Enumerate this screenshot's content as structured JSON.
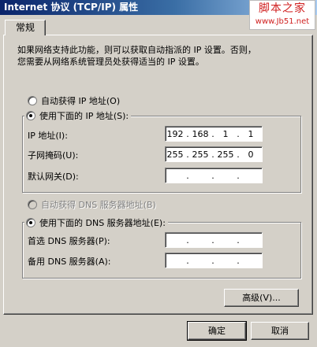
{
  "window": {
    "title": "Internet 协议 (TCP/IP) 属性"
  },
  "watermark": {
    "top": "脚本之家",
    "bottom": "www.Jb51.net"
  },
  "tab": {
    "label": "常规"
  },
  "description": "如果网络支持此功能，则可以获取自动指派的 IP 设置。否则，\n您需要从网络系统管理员处获得适当的 IP 设置。",
  "ip_mode": {
    "auto_label": "自动获得 IP 地址(O)",
    "manual_label": "使用下面的 IP 地址(S):",
    "selected": "manual"
  },
  "ip_fields": {
    "ip_address": {
      "label": "IP 地址(I):",
      "value": [
        "192",
        "168",
        "1",
        "1"
      ]
    },
    "subnet_mask": {
      "label": "子网掩码(U):",
      "value": [
        "255",
        "255",
        "255",
        "0"
      ]
    },
    "default_gateway": {
      "label": "默认网关(D):",
      "value": [
        "",
        "",
        "",
        ""
      ]
    }
  },
  "dns_mode": {
    "auto_label": "自动获得 DNS 服务器地址(B)",
    "manual_label": "使用下面的 DNS 服务器地址(E):",
    "selected": "manual",
    "auto_disabled": true
  },
  "dns_fields": {
    "preferred": {
      "label": "首选 DNS 服务器(P):",
      "value": [
        "",
        "",
        "",
        ""
      ]
    },
    "alternate": {
      "label": "备用 DNS 服务器(A):",
      "value": [
        "",
        "",
        "",
        ""
      ]
    }
  },
  "buttons": {
    "advanced": "高级(V)...",
    "ok": "确定",
    "cancel": "取消"
  },
  "colors": {
    "title_bar_start": "#0a246a",
    "title_bar_end": "#a6caf0",
    "dialog_background": "#d4d0c8",
    "watermark_text": "#d02020"
  }
}
